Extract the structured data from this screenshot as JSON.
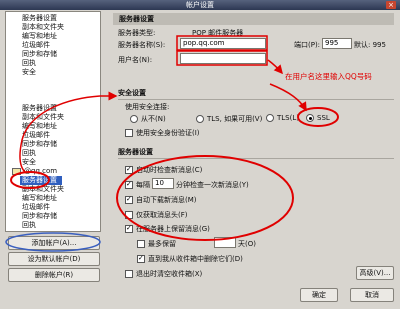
{
  "window": {
    "title": "帐户设置",
    "close_symbol": "×"
  },
  "sidebar": {
    "groups": [
      {
        "items": [
          {
            "label": "服务器设置"
          },
          {
            "label": "副本和文件夹"
          },
          {
            "label": "编写和地址"
          },
          {
            "label": "垃圾邮件"
          },
          {
            "label": "同步和存储"
          },
          {
            "label": "回执"
          },
          {
            "label": "安全"
          }
        ]
      },
      {
        "items": [
          {
            "label": "服务器设置"
          },
          {
            "label": "副本和文件夹"
          },
          {
            "label": "编写和地址"
          },
          {
            "label": "垃圾邮件"
          },
          {
            "label": "同步和存储"
          },
          {
            "label": "回执"
          },
          {
            "label": "安全"
          }
        ]
      },
      {
        "account": "@qq.com",
        "items": [
          {
            "label": "服务器设置",
            "selected": true
          },
          {
            "label": "副本和文件夹"
          },
          {
            "label": "编写和地址"
          },
          {
            "label": "垃圾邮件"
          },
          {
            "label": "同步和存储"
          },
          {
            "label": "回执"
          }
        ]
      }
    ]
  },
  "account_buttons": {
    "add": "添加帐户(A)...",
    "set_default": "设为默认帐户(D)",
    "remove": "删除帐户(R)"
  },
  "panel": {
    "title": "服务器设置",
    "server_type_label": "服务器类型:",
    "server_type_value": "POP 邮件服务器",
    "server_name_label": "服务器名称(S):",
    "server_name_value": "pop.qq.com",
    "port_label": "端口(P):",
    "port_value": "995",
    "default_port": "默认: 995",
    "username_label": "用户名(N):"
  },
  "security": {
    "title": "安全设置",
    "connection_label": "使用安全连接:",
    "options": [
      {
        "label": "从不(N)",
        "selected": false
      },
      {
        "label": "TLS, 如果可用(V)",
        "selected": false
      },
      {
        "label": "TLS(L)",
        "selected": false
      },
      {
        "label": "SSL",
        "selected": true
      }
    ],
    "secure_auth": {
      "label": "使用安全身份验证(I)",
      "checked": false
    }
  },
  "server_settings": {
    "title": "服务器设置",
    "check_on_startup": {
      "label": "启动时检查新消息(C)",
      "checked": true
    },
    "check_every": {
      "prefix": "每隔",
      "minutes": "10",
      "suffix": "分钟检查一次新消息(Y)",
      "checked": true
    },
    "auto_download": {
      "label": "自动下载新消息(M)",
      "checked": true
    },
    "headers_only": {
      "label": "仅获取消息头(F)",
      "checked": false
    },
    "leave_on_server": {
      "label": "在服务器上保留消息(G)",
      "checked": true
    },
    "keep_days": {
      "prefix": "最多保留",
      "suffix": "天(O)",
      "checked": false
    },
    "until_deleted": {
      "label": "直到我从收件箱中删除它们(D)",
      "checked": true
    },
    "empty_on_exit": {
      "label": "退出时清空收件箱(X)",
      "checked": false
    },
    "advanced": "高级(V)..."
  },
  "dialog_buttons": {
    "ok": "确定",
    "cancel": "取消"
  },
  "annotation": {
    "note": "在用户名这里输入QQ号码",
    "color": "#e00000",
    "highlight_color": "#3a5fbf"
  },
  "colors": {
    "titlebar": "#2d3853",
    "selection": "#2f5fbf",
    "background": "#d8d5cf"
  }
}
